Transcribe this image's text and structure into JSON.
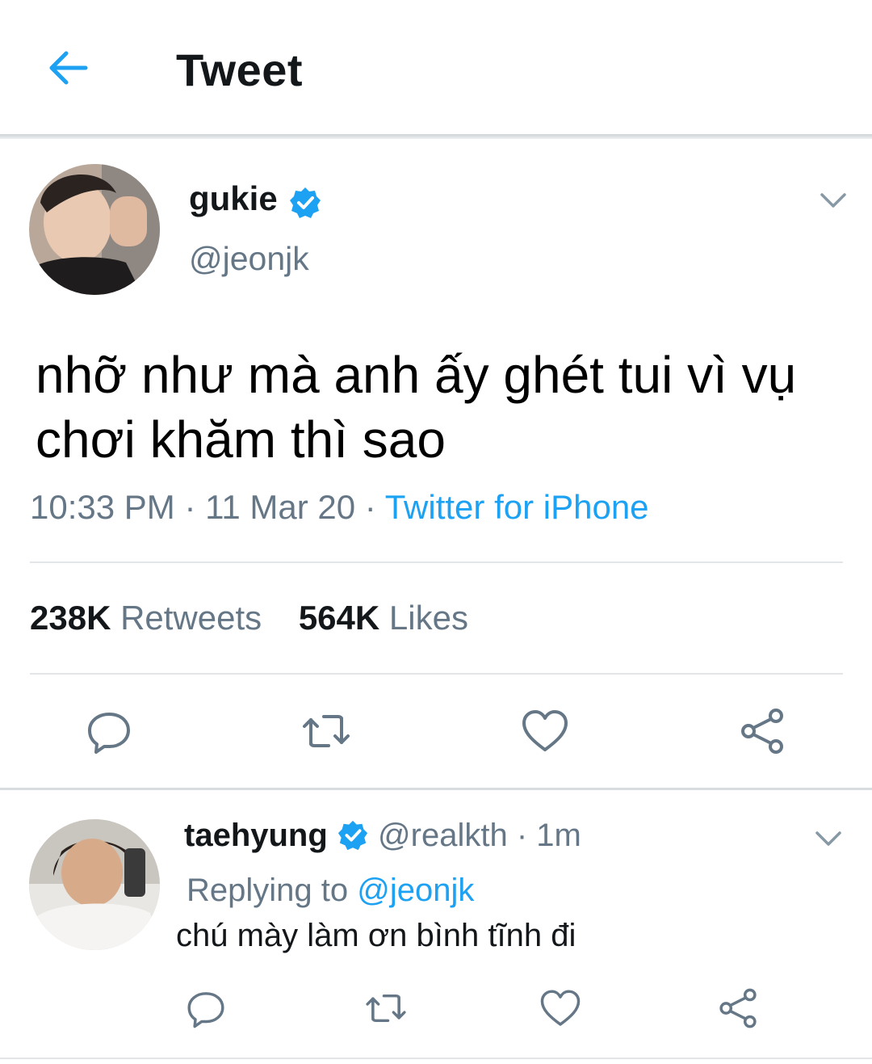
{
  "header": {
    "title": "Tweet",
    "back_icon": "arrow-left-icon",
    "accent": "#1da1f2"
  },
  "tweet": {
    "author_name": "gukie",
    "author_handle": "@jeonjk",
    "verified": true,
    "text": "nhỡ như mà anh ấy ghét tui vì vụ chơi khăm thì sao",
    "time": "10:33 PM",
    "date": "11 Mar 20",
    "source": "Twitter for iPhone",
    "retweets_count": "238K",
    "retweets_label": "Retweets",
    "likes_count": "564K",
    "likes_label": "Likes"
  },
  "reply": {
    "author_name": "taehyung",
    "author_handle": "@realkth",
    "age": "1m",
    "replying_prefix": "Replying to",
    "replying_to": "@jeonjk",
    "text": "chú mày làm ơn bình tĩnh đi"
  },
  "separators": {
    "dot": "·"
  },
  "icons": [
    "reply-icon",
    "retweet-icon",
    "like-icon",
    "share-icon",
    "chevron-down-icon",
    "verified-badge-icon"
  ]
}
